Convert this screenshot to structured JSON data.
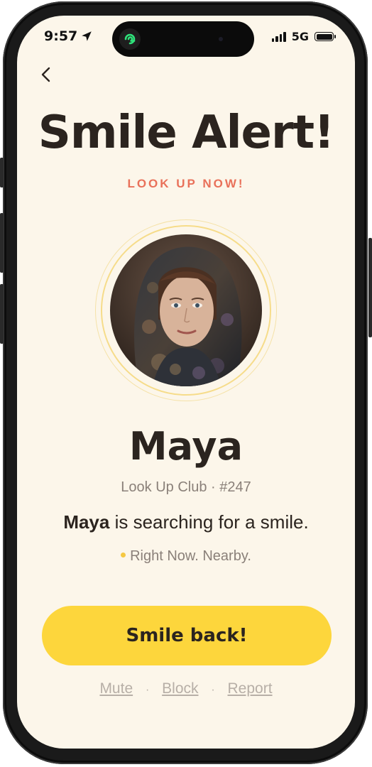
{
  "status_bar": {
    "time": "9:57",
    "network": "5G",
    "icons": [
      "location-arrow-icon",
      "signal-bars-icon",
      "battery-icon"
    ]
  },
  "nav": {
    "back_icon": "chevron-left-icon"
  },
  "alert": {
    "title": "Smile Alert!",
    "subtitle": "LOOK UP NOW!"
  },
  "profile": {
    "name": "Maya",
    "club_line": "Look Up Club · #247",
    "message_name": "Maya",
    "message_rest": " is searching for a smile.",
    "presence": "Right Now. Nearby."
  },
  "actions": {
    "primary_label": "Smile back!",
    "mute": "Mute",
    "separator": "·",
    "block": "Block",
    "report": "Report"
  },
  "colors": {
    "background": "#fcf6ea",
    "accent_yellow": "#fdd63c",
    "subtitle_coral": "#e9715a",
    "text_dark": "#2b241f",
    "text_muted": "#8a8079"
  }
}
